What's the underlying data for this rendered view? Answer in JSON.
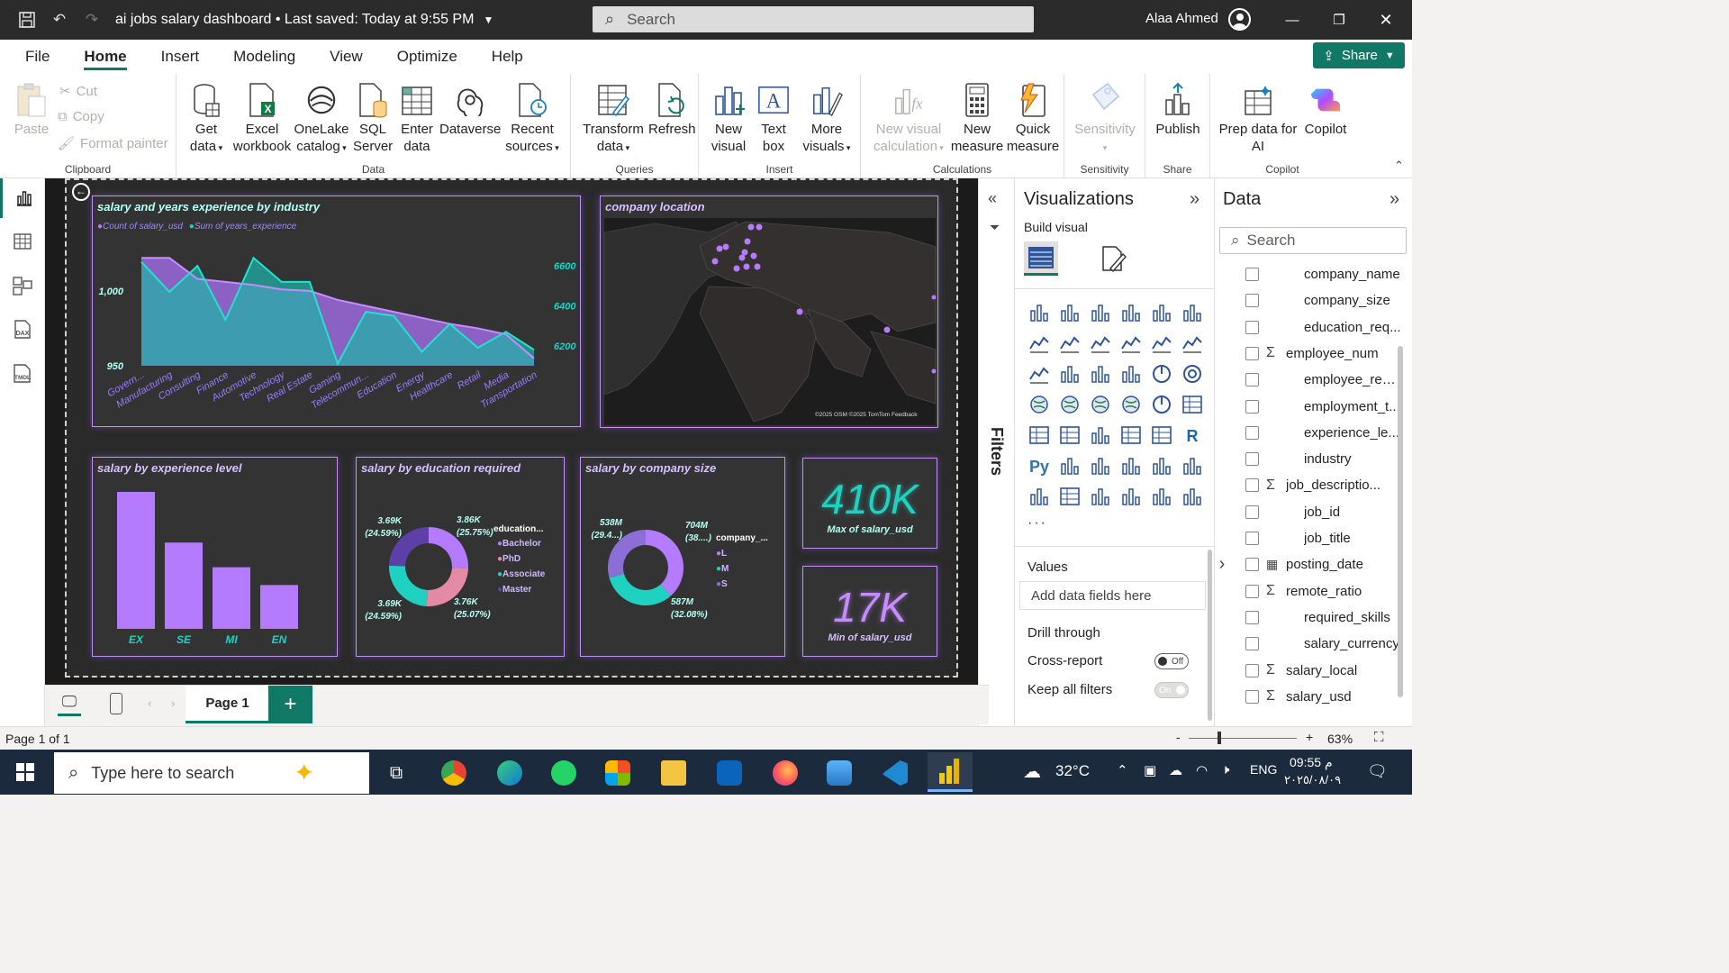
{
  "window": {
    "title": "ai jobs salary dashboard • Last saved: Today at 9:55 PM",
    "search_placeholder": "Search",
    "user": "Alaa Ahmed"
  },
  "menu": {
    "items": [
      "File",
      "Home",
      "Insert",
      "Modeling",
      "View",
      "Optimize",
      "Help"
    ],
    "active": "Home",
    "share": "Share"
  },
  "ribbon": {
    "clipboard": {
      "label": "Clipboard",
      "paste": "Paste",
      "cut": "Cut",
      "copy": "Copy",
      "format_painter": "Format painter"
    },
    "data": {
      "label": "Data",
      "get_data": "Get data",
      "excel": "Excel workbook",
      "onelake": "OneLake catalog",
      "sql": "SQL Server",
      "enter": "Enter data",
      "dataverse": "Dataverse",
      "recent": "Recent sources"
    },
    "queries": {
      "label": "Queries",
      "transform": "Transform data",
      "refresh": "Refresh"
    },
    "insert": {
      "label": "Insert",
      "new_visual": "New visual",
      "text_box": "Text box",
      "more_visuals": "More visuals"
    },
    "calculations": {
      "label": "Calculations",
      "new_visual_calc": "New visual calculation",
      "new_measure": "New measure",
      "quick_measure": "Quick measure"
    },
    "sensitivity": {
      "label": "Sensitivity",
      "btn": "Sensitivity"
    },
    "share": {
      "label": "Share",
      "publish": "Publish"
    },
    "copilot": {
      "label": "Copilot",
      "prep": "Prep data for AI",
      "copilot": "Copilot"
    }
  },
  "report": {
    "area_chart": {
      "title": "salary and years experience by industry",
      "legend1": "Count of salary_usd",
      "legend2": "Sum of years_experience"
    },
    "map": {
      "title": "company location",
      "credit": "©2025 OSM  ©2025 TomTom  Feedback"
    },
    "bar_chart": {
      "title": "salary by experience level"
    },
    "donut_edu": {
      "title": "salary by education required",
      "legend_title": "education...",
      "legend": [
        "Bachelor",
        "PhD",
        "Associate",
        "Master"
      ]
    },
    "donut_size": {
      "title": "salary by company size",
      "legend_title": "company_...",
      "legend": [
        "L",
        "M",
        "S"
      ]
    },
    "card_max": {
      "value": "410K",
      "label": "Max of salary_usd"
    },
    "card_min": {
      "value": "17K",
      "label": "Min of salary_usd"
    }
  },
  "chart_data": [
    {
      "type": "area",
      "title": "salary and years experience by industry",
      "categories": [
        "Govern...",
        "Manufacturing",
        "Consulting",
        "Finance",
        "Automotive",
        "Technology",
        "Real Estate",
        "Gaming",
        "Telecommun...",
        "Education",
        "Energy",
        "Healthcare",
        "Retail",
        "Media",
        "Transportation"
      ],
      "series": [
        {
          "name": "Count of salary_usd",
          "axis": "left",
          "values": [
            1022,
            1022,
            1008,
            1006,
            1004,
            1001,
            1000,
            994,
            990,
            986,
            982,
            978,
            975,
            971,
            955
          ]
        },
        {
          "name": "Sum of years_experience",
          "axis": "right",
          "values": [
            6620,
            6470,
            6600,
            6330,
            6640,
            6520,
            6520,
            6110,
            6370,
            6350,
            6170,
            6310,
            6190,
            6270,
            6180
          ]
        }
      ],
      "left_ticks": [
        "950",
        "1,000"
      ],
      "right_ticks": [
        "6200",
        "6400",
        "6600"
      ],
      "ylim_left": [
        950,
        1030
      ],
      "ylim_right": [
        6100,
        6700
      ]
    },
    {
      "type": "bar",
      "title": "salary by experience level",
      "categories": [
        "EX",
        "SE",
        "MI",
        "EN"
      ],
      "values": [
        100,
        63,
        45,
        32
      ]
    },
    {
      "type": "pie",
      "title": "salary by education required",
      "labels": [
        "Bachelor",
        "PhD",
        "Associate",
        "Master"
      ],
      "values": [
        3.86,
        3.76,
        3.69,
        3.69
      ],
      "data_labels": [
        "3.86K (25.75%)",
        "3.76K (25.07%)",
        "3.69K (24.59%)",
        "3.69K (24.59%)"
      ]
    },
    {
      "type": "pie",
      "title": "salary by company size",
      "labels": [
        "L",
        "M",
        "S"
      ],
      "values": [
        704,
        587,
        538
      ],
      "data_labels": [
        "704M (38....)",
        "587M (32.08%)",
        "538M (29.4...)"
      ]
    }
  ],
  "filters": {
    "label": "Filters"
  },
  "visualizations": {
    "title": "Visualizations",
    "build_visual": "Build visual",
    "values": "Values",
    "add_fields": "Add data fields here",
    "drill_through": "Drill through",
    "cross_report": "Cross-report",
    "cross_report_state": "Off",
    "keep_filters": "Keep all filters",
    "keep_filters_state": "On"
  },
  "data_pane": {
    "title": "Data",
    "search_placeholder": "Search",
    "fields": [
      {
        "name": "company_name",
        "sigma": false,
        "expand": false
      },
      {
        "name": "company_size",
        "sigma": false,
        "expand": false
      },
      {
        "name": "education_req...",
        "sigma": false,
        "expand": false
      },
      {
        "name": "employee_num",
        "sigma": true,
        "expand": false
      },
      {
        "name": "employee_resi...",
        "sigma": false,
        "expand": false
      },
      {
        "name": "employment_t...",
        "sigma": false,
        "expand": false
      },
      {
        "name": "experience_le...",
        "sigma": false,
        "expand": false
      },
      {
        "name": "industry",
        "sigma": false,
        "expand": false
      },
      {
        "name": "job_descriptio...",
        "sigma": true,
        "expand": false
      },
      {
        "name": "job_id",
        "sigma": false,
        "expand": false
      },
      {
        "name": "job_title",
        "sigma": false,
        "expand": false
      },
      {
        "name": "posting_date",
        "sigma": false,
        "expand": true,
        "calendar": true
      },
      {
        "name": "remote_ratio",
        "sigma": true,
        "expand": false
      },
      {
        "name": "required_skills",
        "sigma": false,
        "expand": false
      },
      {
        "name": "salary_currency",
        "sigma": false,
        "expand": false
      },
      {
        "name": "salary_local",
        "sigma": true,
        "expand": false
      },
      {
        "name": "salary_usd",
        "sigma": true,
        "expand": false
      }
    ]
  },
  "pages": {
    "tab": "Page 1",
    "status": "Page 1 of 1",
    "zoom": "63%"
  },
  "taskbar": {
    "search_placeholder": "Type here to search",
    "temperature": "32°C",
    "lang": "ENG",
    "time": "09:55 م",
    "date": "٢٠٢٥/٠٨/٠٩"
  },
  "colors": {
    "accent": "#117865",
    "purple": "#b57bff",
    "teal": "#1fd1c1",
    "pink": "#e48aa6"
  }
}
